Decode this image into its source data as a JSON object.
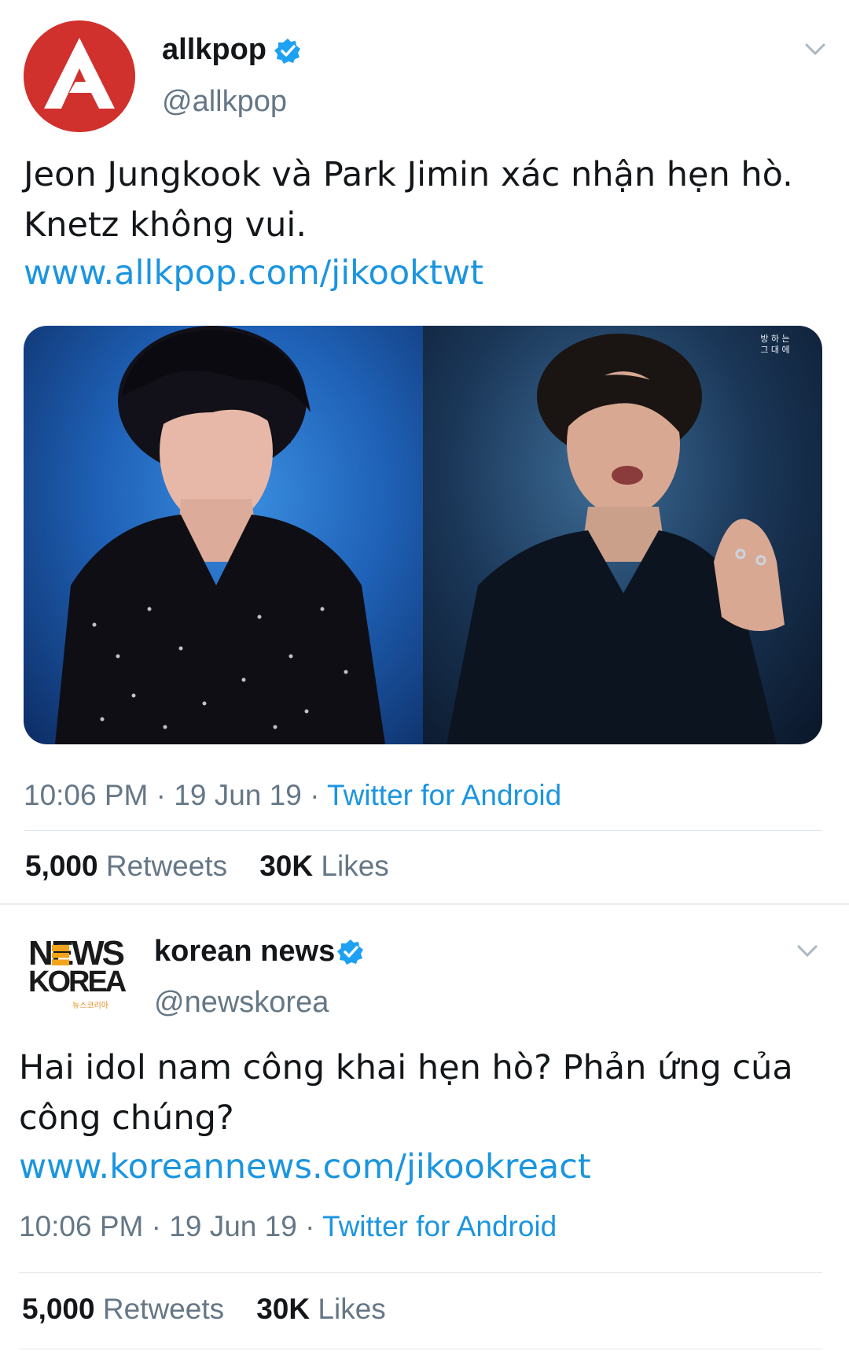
{
  "tweets": [
    {
      "author": {
        "name": "allkpop",
        "handle": "@allkpop",
        "verified": true,
        "avatar_color": "#d0312d"
      },
      "text_line1": "Jeon Jungkook và Park Jimin xác nhận hẹn hò.",
      "text_line2": "Knetz không vui.",
      "link": "www.allkpop.com/jikooktwt",
      "meta": {
        "time": "10:06 PM",
        "date": "19 Jun 19",
        "source": "Twitter for Android"
      },
      "stats": {
        "retweets_count": "5,000",
        "retweets_label": "Retweets",
        "likes_count": "30K",
        "likes_label": "Likes"
      },
      "media_caption": "방 하 는 그 대 에"
    },
    {
      "author": {
        "name": "korean news",
        "handle": "@newskorea",
        "verified": true,
        "logo_line1": "NEWS",
        "logo_line2": "KOREA",
        "logo_small": "뉴스코리아"
      },
      "text_line1": "Hai idol nam công khai hẹn hò? Phản ứng của",
      "text_line2": "công chúng?",
      "link": "www.koreannews.com/jikookreact",
      "meta": {
        "time": "10:06 PM",
        "date": "19 Jun 19",
        "source": "Twitter for Android"
      },
      "stats": {
        "retweets_count": "5,000",
        "retweets_label": "Retweets",
        "likes_count": "30K",
        "likes_label": "Likes"
      }
    }
  ],
  "colors": {
    "link": "#1b95e0",
    "muted": "#657786",
    "verified": "#1da1f2",
    "text": "#14171a"
  },
  "icons": {
    "verified": "verified-badge-icon",
    "caret": "chevron-down-icon"
  },
  "separator": "·"
}
